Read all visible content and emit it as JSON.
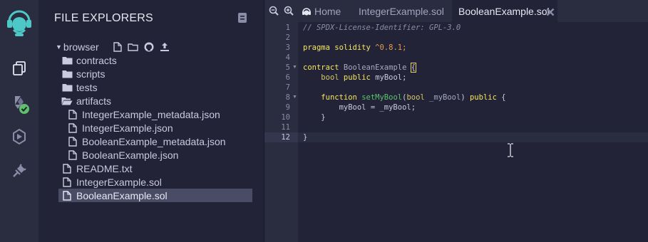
{
  "rail": {
    "items": [
      {
        "name": "remix-logo-icon"
      },
      {
        "name": "file-explorer-icon"
      },
      {
        "name": "solidity-compiler-icon"
      },
      {
        "name": "deploy-run-icon"
      },
      {
        "name": "plugin-manager-icon"
      }
    ]
  },
  "explorer": {
    "title": "FILE EXPLORERS",
    "workspace": "browser",
    "tree": [
      {
        "label": "contracts",
        "kind": "folder"
      },
      {
        "label": "scripts",
        "kind": "folder"
      },
      {
        "label": "tests",
        "kind": "folder"
      },
      {
        "label": "artifacts",
        "kind": "folder-open"
      },
      {
        "label": "IntegerExample_metadata.json",
        "kind": "file"
      },
      {
        "label": "IntegerExample.json",
        "kind": "file"
      },
      {
        "label": "BooleanExample_metadata.json",
        "kind": "file"
      },
      {
        "label": "BooleanExample.json",
        "kind": "file"
      },
      {
        "label": "README.txt",
        "kind": "file"
      },
      {
        "label": "IntegerExample.sol",
        "kind": "file"
      },
      {
        "label": "BooleanExample.sol",
        "kind": "file",
        "selected": true
      }
    ]
  },
  "editor": {
    "tabs": [
      {
        "label": "Home"
      },
      {
        "label": "IntegerExample.sol"
      },
      {
        "label": "BooleanExample.sol",
        "active": true
      }
    ],
    "line_numbers": [
      "1",
      "2",
      "3",
      "4",
      "5",
      "6",
      "7",
      "8",
      "9",
      "10",
      "11",
      "12"
    ],
    "code": {
      "l1": "// SPDX-License-Identifier: GPL-3.0",
      "l3_kw": "pragma solidity",
      "l3_ver": "^0.8.1;",
      "l5_kw": "contract",
      "l5_name": "BooleanExample",
      "l5_brace": "{",
      "l6_type": "bool",
      "l6_kw": "public",
      "l6_rest": "myBool;",
      "l8_kw": "function",
      "l8_fn": "setMyBool",
      "l8_open": "(",
      "l8_type": "bool",
      "l8_param": "_myBool",
      "l8_close": ")",
      "l8_pub": "public",
      "l8_brace": "{",
      "l9": "myBool = _myBool;",
      "l10": "}",
      "l12": "}"
    }
  },
  "colors": {
    "accent": "#4dc8c6",
    "check": "#5fc16b",
    "background": "#222336",
    "panel": "#2a2c3f"
  }
}
